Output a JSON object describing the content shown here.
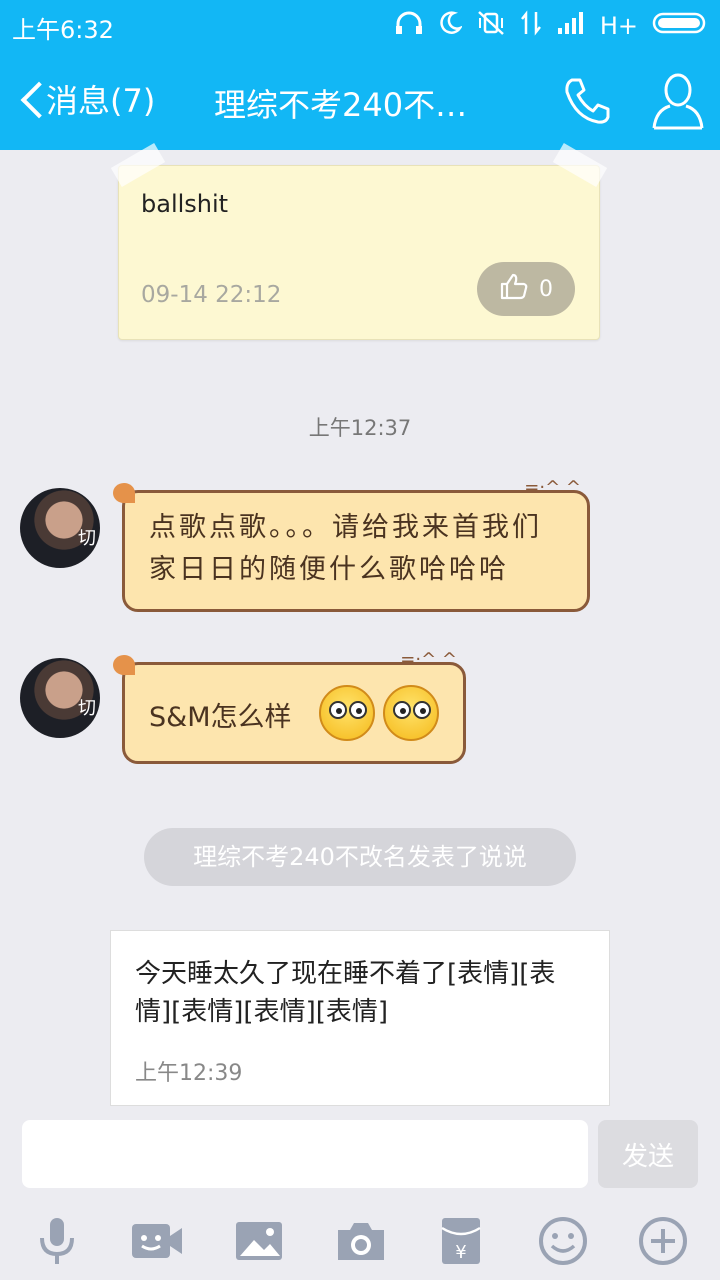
{
  "status_bar": {
    "time": "上午6:32",
    "network": "H+"
  },
  "header": {
    "back_label": "消息(7)",
    "title": "理综不考240不…"
  },
  "messages": {
    "note": {
      "text": "ballshit",
      "date": "09-14 22:12",
      "like_count": "0"
    },
    "timestamp_1": "上午12:37",
    "bubble_1": "点歌点歌。。。请给我来首我们家日日的随便什么歌哈哈哈",
    "bubble_2": "S&M怎么样",
    "avatar_tag": "切",
    "system_notice": "理综不考240不改名发表了说说",
    "feed": {
      "text": "今天睡太久了现在睡不着了[表情][表情][表情][表情][表情]",
      "time": "上午12:39"
    }
  },
  "composer": {
    "send_label": "发送"
  },
  "toolbar": [
    "mic-icon",
    "video-icon",
    "image-icon",
    "camera-icon",
    "red-packet-icon",
    "emoji-icon",
    "plus-icon"
  ],
  "colors": {
    "header_bg": "#12b7f5",
    "bubble_bg": "#fde5ae",
    "bubble_border": "#8a5a3a"
  }
}
